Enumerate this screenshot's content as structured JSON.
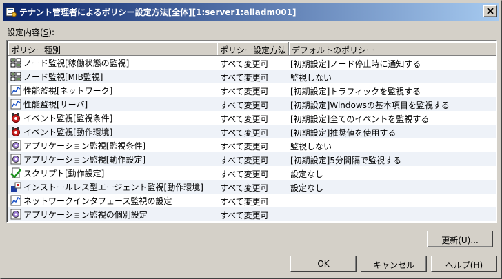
{
  "window": {
    "title": "テナント管理者によるポリシー設定方法[全体][1:server1:alladm001]",
    "close_label": "×"
  },
  "content_label": {
    "text": "設定内容(",
    "mnemonic": "S",
    "suffix": "):"
  },
  "columns": [
    "ポリシー種別",
    "ポリシー設定方法",
    "デフォルトのポリシー"
  ],
  "rows": [
    {
      "icon": "node-monitor-icon",
      "type": "ノード監視[稼働状態の監視]",
      "method": "すべて変更可",
      "default": "[初期設定]ノード停止時に通知する"
    },
    {
      "icon": "node-monitor-icon",
      "type": "ノード監視[MIB監視]",
      "method": "すべて変更可",
      "default": "監視しない"
    },
    {
      "icon": "performance-chart-icon",
      "type": "性能監視[ネットワーク]",
      "method": "すべて変更可",
      "default": "[初期設定]トラフィックを監視する"
    },
    {
      "icon": "performance-chart-icon",
      "type": "性能監視[サーバ]",
      "method": "すべて変更可",
      "default": "[初期設定]Windowsの基本項目を監視する"
    },
    {
      "icon": "event-monitor-icon",
      "type": "イベント監視[監視条件]",
      "method": "すべて変更可",
      "default": "[初期設定]全てのイベントを監視する"
    },
    {
      "icon": "event-monitor-icon",
      "type": "イベント監視[動作環境]",
      "method": "すべて変更可",
      "default": "[初期設定]推奨値を使用する"
    },
    {
      "icon": "application-monitor-icon",
      "type": "アプリケーション監視[監視条件]",
      "method": "すべて変更可",
      "default": "監視しない"
    },
    {
      "icon": "application-monitor-icon",
      "type": "アプリケーション監視[動作設定]",
      "method": "すべて変更可",
      "default": "[初期設定]5分間隔で監視する"
    },
    {
      "icon": "script-icon",
      "type": "スクリプト[動作設定]",
      "method": "すべて変更可",
      "default": "設定なし"
    },
    {
      "icon": "agentless-monitor-icon",
      "type": "インストールレス型エージェント監視[動作環境]",
      "method": "すべて変更可",
      "default": "設定なし"
    },
    {
      "icon": "performance-chart-icon",
      "type": "ネットワークインタフェース監視の設定",
      "method": "すべて変更可",
      "default": ""
    },
    {
      "icon": "application-monitor-icon",
      "type": "アプリケーション監視の個別設定",
      "method": "すべて変更可",
      "default": ""
    }
  ],
  "buttons": {
    "update": "更新(U)...",
    "ok": "OK",
    "cancel": "キャンセル",
    "help": "ヘルプ(H)"
  },
  "colors": {
    "title_gradient_start": "#0a246a",
    "title_gradient_end": "#a6caf0",
    "face": "#d4d0c8"
  }
}
